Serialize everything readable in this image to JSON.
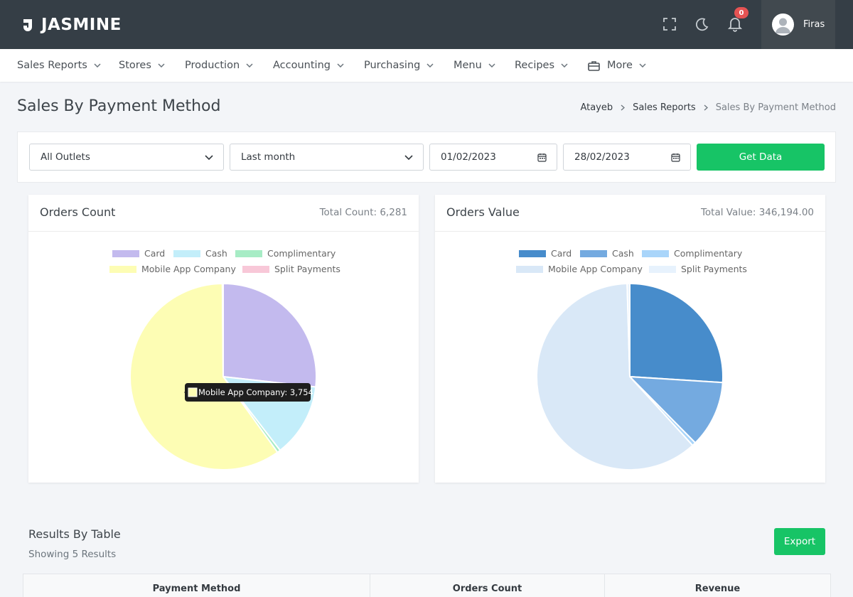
{
  "app": {
    "brand": "JASMINE",
    "user_name": "Firas",
    "notification_count": "0"
  },
  "icons": {
    "fullscreen": "fullscreen-icon",
    "theme": "moon-icon",
    "notifications": "bell-icon",
    "avatar": "user-icon",
    "more": "briefcase-icon",
    "calendar": "calendar-icon",
    "dropdown": "chevron-down-icon",
    "breadcrumb_sep": "chevron-right-icon"
  },
  "nav": {
    "items": [
      {
        "label": "Sales Reports"
      },
      {
        "label": "Stores"
      },
      {
        "label": "Production"
      },
      {
        "label": "Accounting"
      },
      {
        "label": "Purchasing"
      },
      {
        "label": "Menu"
      },
      {
        "label": "Recipes"
      },
      {
        "label": "More"
      }
    ]
  },
  "page": {
    "title": "Sales By Payment Method",
    "breadcrumb": [
      "Atayeb",
      "Sales Reports",
      "Sales By Payment Method"
    ]
  },
  "filters": {
    "outlet": "All Outlets",
    "period": "Last month",
    "date_from": "01/02/2023",
    "date_to": "28/02/2023",
    "get_data_label": "Get Data"
  },
  "orders_count_card": {
    "title": "Orders Count",
    "total_label": "Total Count: 6,281",
    "tooltip": "Mobile App Company: 3,754"
  },
  "orders_value_card": {
    "title": "Orders Value",
    "total_label": "Total Value: 346,194.00"
  },
  "chart_data": [
    {
      "type": "pie",
      "title": "Orders Count",
      "legend": [
        "Card",
        "Cash",
        "Complimentary",
        "Mobile App Company",
        "Split Payments"
      ],
      "legend_position": "top",
      "values": [
        1681,
        802,
        35,
        3754,
        9
      ],
      "colors": [
        "#c3baee",
        "#c3eefa",
        "#a7ecc5",
        "#fdfdb4",
        "#f8c8d8"
      ],
      "tooltip": {
        "label": "Mobile App Company",
        "value": 3754
      }
    },
    {
      "type": "pie",
      "title": "Orders Value",
      "legend": [
        "Card",
        "Cash",
        "Complimentary",
        "Mobile App Company",
        "Split Payments"
      ],
      "legend_position": "top",
      "values": [
        90000,
        40100,
        2200,
        212300,
        1594
      ],
      "colors": [
        "#478ccb",
        "#74aae0",
        "#a9d5fa",
        "#d9e8f7",
        "#e7f2fd"
      ]
    }
  ],
  "results": {
    "title": "Results By Table",
    "subtitle": "Showing 5 Results",
    "export_label": "Export",
    "columns": [
      "Payment Method",
      "Orders Count",
      "Revenue"
    ]
  }
}
